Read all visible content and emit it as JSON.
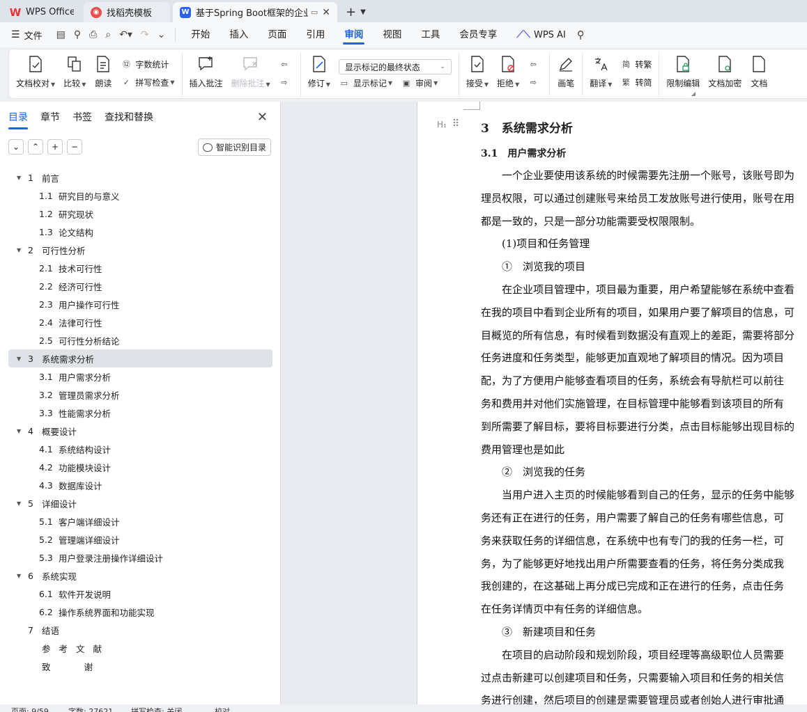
{
  "tabs": [
    {
      "label": "WPS Office"
    },
    {
      "label": "找稻壳模板"
    },
    {
      "label": "基于Spring Boot框架的企业项"
    }
  ],
  "menu": {
    "file": "文件",
    "tabs": [
      "开始",
      "插入",
      "页面",
      "引用",
      "审阅",
      "视图",
      "工具",
      "会员专享"
    ],
    "active_tab": "审阅",
    "ai": "WPS AI"
  },
  "ribbon": {
    "doc_check": "文档校对",
    "compare": "比较",
    "read_aloud": "朗读",
    "word_count": "字数统计",
    "spell_check": "拼写检查",
    "insert_comment": "插入批注",
    "delete_comment": "删除批注",
    "revise": "修订",
    "markup_state": "显示标记的最终状态",
    "show_markup": "显示标记",
    "review": "审阅",
    "accept": "接受",
    "reject": "拒绝",
    "pen": "画笔",
    "translate": "翻译",
    "to_traditional": "转繁",
    "to_simplified": "转简",
    "restrict_edit": "限制编辑",
    "encrypt": "文档加密",
    "doc_more": "文档"
  },
  "nav": {
    "tabs": [
      "目录",
      "章节",
      "书签",
      "查找和替换"
    ],
    "active_tab": "目录",
    "smart_toc": "智能识别目录",
    "toc": [
      {
        "level": 1,
        "num": "1",
        "label": "前言",
        "expanded": true
      },
      {
        "level": 2,
        "num": "1.1",
        "label": "研究目的与意义"
      },
      {
        "level": 2,
        "num": "1.2",
        "label": "研究现状"
      },
      {
        "level": 2,
        "num": "1.3",
        "label": "论文结构"
      },
      {
        "level": 1,
        "num": "2",
        "label": "可行性分析",
        "expanded": true
      },
      {
        "level": 2,
        "num": "2.1",
        "label": "技术可行性"
      },
      {
        "level": 2,
        "num": "2.2",
        "label": "经济可行性"
      },
      {
        "level": 2,
        "num": "2.3",
        "label": "用户操作可行性"
      },
      {
        "level": 2,
        "num": "2.4",
        "label": "法律可行性"
      },
      {
        "level": 2,
        "num": "2.5",
        "label": "可行性分析结论"
      },
      {
        "level": 1,
        "num": "3",
        "label": "系统需求分析",
        "expanded": true,
        "selected": true
      },
      {
        "level": 2,
        "num": "3.1",
        "label": "用户需求分析"
      },
      {
        "level": 2,
        "num": "3.2",
        "label": "管理员需求分析"
      },
      {
        "level": 2,
        "num": "3.3",
        "label": "性能需求分析"
      },
      {
        "level": 1,
        "num": "4",
        "label": "概要设计",
        "expanded": true
      },
      {
        "level": 2,
        "num": "4.1",
        "label": "系统结构设计"
      },
      {
        "level": 2,
        "num": "4.2",
        "label": "功能模块设计"
      },
      {
        "level": 2,
        "num": "4.3",
        "label": "数据库设计"
      },
      {
        "level": 1,
        "num": "5",
        "label": "详细设计",
        "expanded": true
      },
      {
        "level": 2,
        "num": "5.1",
        "label": "客户端详细设计"
      },
      {
        "level": 2,
        "num": "5.2",
        "label": "管理端详细设计"
      },
      {
        "level": 2,
        "num": "5.3",
        "label": "用户登录注册操作详细设计"
      },
      {
        "level": 1,
        "num": "6",
        "label": "系统实现",
        "expanded": true
      },
      {
        "level": 2,
        "num": "6.1",
        "label": "软件开发说明"
      },
      {
        "level": 2,
        "num": "6.2",
        "label": "操作系统界面和功能实现"
      },
      {
        "level": 1,
        "num": "7",
        "label": "结语"
      },
      {
        "level": 1,
        "num": "",
        "label": "参考文献"
      },
      {
        "level": 1,
        "num": "",
        "label": "致谢"
      }
    ]
  },
  "doc": {
    "h1_num": "3",
    "h1_text": "系统需求分析",
    "h2_num": "3.1",
    "h2_text": "用户需求分析",
    "lines": [
      "　　一个企业要使用该系统的时候需要先注册一个账号，该账号即为",
      "理员权限，可以通过创建账号来给员工发放账号进行使用，账号在用",
      "都是一致的，只是一部分功能需要受权限限制。",
      "　　(1)项目和任务管理",
      "　　①　浏览我的项目",
      "　　在企业项目管理中，项目最为重要，用户希望能够在系统中查看",
      "在我的项目中看到企业所有的项目，如果用户要了解项目的信息，可",
      "目概览的所有信息，有时候看到数据没有直观上的差距，需要将部分",
      "任务进度和任务类型，能够更加直观地了解项目的情况。因为项目",
      "配，为了方便用户能够查看项目的任务，系统会有导航栏可以前往",
      "务和费用并对他们实施管理，在目标管理中能够看到该项目的所有",
      "到所需要了解目标，要将目标要进行分类，点击目标能够出现目标的",
      "费用管理也是如此",
      "　　②　浏览我的任务",
      "　　当用户进入主页的时候能够看到自己的任务，显示的任务中能够",
      "务还有正在进行的任务，用户需要了解自己的任务有哪些信息，可",
      "务来获取任务的详细信息，在系统中也有专门的我的任务一栏，可",
      "务，为了能够更好地找出用户所需要查看的任务，将任务分类成我",
      "我创建的，在这基础上再分成已完成和正在进行的任务，点击任务",
      "在任务详情页中有任务的详细信息。",
      "　　③　新建项目和任务",
      "　　在项目的启动阶段和规划阶段，项目经理等高级职位人员需要",
      "过点击新建可以创建项目和任务，只需要输入项目和任务的相关信",
      "务进行创建，然后项目的创建是需要管理员或者创始人进行审批通"
    ]
  },
  "status": {
    "page": "页面: 9/59",
    "words": "字数: 27621",
    "spell": "拼写检查: 关闭",
    "proof": "校对"
  },
  "colors": {
    "accent": "#1f63e0",
    "wps_red": "#e63232"
  }
}
